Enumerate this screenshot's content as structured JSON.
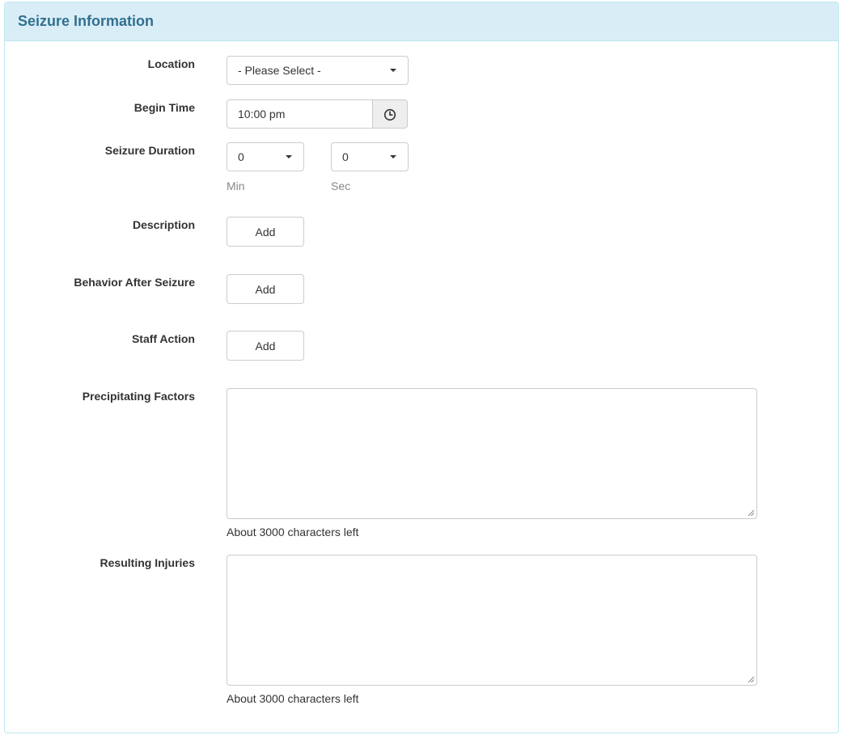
{
  "panel": {
    "title": "Seizure Information"
  },
  "form": {
    "location": {
      "label": "Location",
      "selected": "- Please Select -"
    },
    "begin_time": {
      "label": "Begin Time",
      "value": "10:00 pm",
      "icon": "clock-icon"
    },
    "seizure_duration": {
      "label": "Seizure Duration",
      "min_value": "0",
      "min_label": "Min",
      "sec_value": "0",
      "sec_label": "Sec"
    },
    "description": {
      "label": "Description",
      "button_label": "Add"
    },
    "behavior_after_seizure": {
      "label": "Behavior After Seizure",
      "button_label": "Add"
    },
    "staff_action": {
      "label": "Staff Action",
      "button_label": "Add"
    },
    "precipitating_factors": {
      "label": "Precipitating Factors",
      "value": "",
      "chars_left": "About 3000 characters left"
    },
    "resulting_injuries": {
      "label": "Resulting Injuries",
      "value": "",
      "chars_left": "About 3000 characters left"
    }
  },
  "colors": {
    "heading_bg": "#d9edf7",
    "heading_text": "#31708f",
    "panel_border": "#bce8f1"
  }
}
